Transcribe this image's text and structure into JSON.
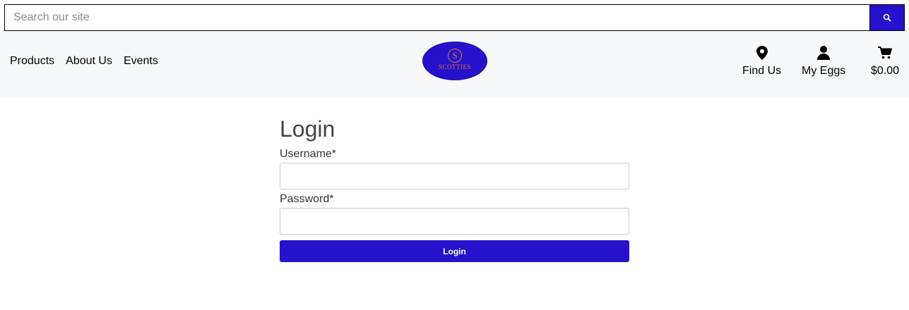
{
  "search": {
    "placeholder": "Search our site",
    "button_icon": "search-icon"
  },
  "header": {
    "nav_left": [
      "Products",
      "About Us",
      "Events"
    ],
    "logo": {
      "letter": "S",
      "name": "SCOTTIES",
      "tagline": "EST MIDDLE ROW"
    },
    "nav_right": [
      {
        "label": "Find Us",
        "icon": "map-pin-icon"
      },
      {
        "label": "My Eggs",
        "icon": "user-icon"
      },
      {
        "label": "$0.00",
        "icon": "cart-icon"
      }
    ]
  },
  "login": {
    "title": "Login",
    "username_label": "Username*",
    "password_label": "Password*",
    "button_label": "Login"
  },
  "colors": {
    "accent": "#2612cc",
    "header_bg": "#f7f8f9",
    "logo_text": "#e0752a"
  }
}
